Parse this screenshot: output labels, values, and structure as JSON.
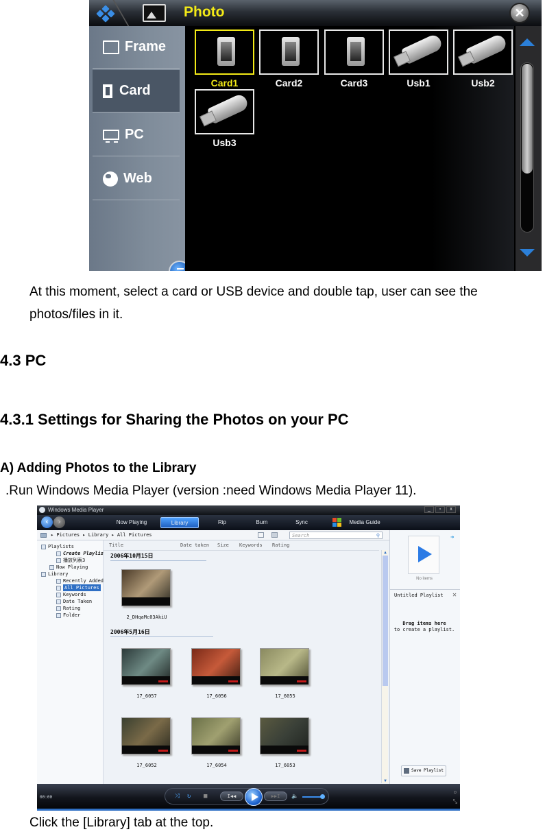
{
  "photo_app": {
    "title": "Photo",
    "sidebar": [
      {
        "label": "Frame",
        "icon": "frame-icon",
        "active": false
      },
      {
        "label": "Card",
        "icon": "card-icon",
        "active": true
      },
      {
        "label": "PC",
        "icon": "pc-icon",
        "active": false
      },
      {
        "label": "Web",
        "icon": "globe-icon",
        "active": false
      }
    ],
    "devices": [
      {
        "label": "Card1",
        "type": "sd-card",
        "selected": true
      },
      {
        "label": "Card2",
        "type": "sd-card",
        "selected": false
      },
      {
        "label": "Card3",
        "type": "sd-card",
        "selected": false
      },
      {
        "label": "Usb1",
        "type": "usb-drive",
        "selected": false
      },
      {
        "label": "Usb2",
        "type": "usb-drive",
        "selected": false
      },
      {
        "label": "Usb3",
        "type": "usb-drive",
        "selected": false
      }
    ],
    "accent_color": "#f3ea17",
    "close_glyph": "✕"
  },
  "document": {
    "para1": "At this moment, select a card or USB device and double tap, user can see the photos/files in it.",
    "heading_43": "4.3 PC",
    "heading_431": "4.3.1 Settings for Sharing the Photos on your PC",
    "heading_a": "A) Adding Photos to the Library",
    "run_line": ".Run Windows Media Player (version :need Windows Media Player 11).",
    "caption": "Click the [Library] tab at the top."
  },
  "wmp": {
    "window_title": "Windows Media Player",
    "window_buttons": [
      "_",
      "▫",
      "x"
    ],
    "back_glyph": "‹",
    "forward_glyph": "›",
    "tabs": [
      {
        "label": "Now Playing",
        "active": false
      },
      {
        "label": "Library",
        "active": true
      },
      {
        "label": "Rip",
        "active": false
      },
      {
        "label": "Burn",
        "active": false
      },
      {
        "label": "Sync",
        "active": false
      },
      {
        "label": "Media Guide",
        "active": false
      }
    ],
    "breadcrumb": "▸ Pictures  ▸ Library  ▸ All Pictures",
    "search_placeholder": "Search",
    "nav_tree": [
      {
        "label": "Playlists",
        "indent": 0,
        "selected": false,
        "italic": false
      },
      {
        "label": "Create Playlist",
        "indent": 1,
        "selected": false,
        "italic": true
      },
      {
        "label": "播放列表3",
        "indent": 1,
        "selected": false,
        "italic": false
      },
      {
        "label": "Now Playing",
        "indent": 0,
        "selected": false,
        "italic": false
      },
      {
        "label": "Library",
        "indent": 0,
        "selected": false,
        "italic": false
      },
      {
        "label": "Recently Added",
        "indent": 1,
        "selected": false,
        "italic": false
      },
      {
        "label": "All Pictures",
        "indent": 1,
        "selected": true,
        "italic": false
      },
      {
        "label": "Keywords",
        "indent": 1,
        "selected": false,
        "italic": false
      },
      {
        "label": "Date Taken",
        "indent": 1,
        "selected": false,
        "italic": false
      },
      {
        "label": "Rating",
        "indent": 1,
        "selected": false,
        "italic": false
      },
      {
        "label": "Folder",
        "indent": 1,
        "selected": false,
        "italic": false
      }
    ],
    "columns": [
      "Title",
      "Date taken",
      "Size",
      "Keywords",
      "Rating"
    ],
    "groups": [
      {
        "header": "2006年10月15日",
        "photos": [
          "2_DHqaMc03AkiU"
        ]
      },
      {
        "header": "2006年5月16日",
        "photos": [
          "17_6057",
          "17_6056",
          "17_6055",
          "17_6052",
          "17_6054",
          "17_6053"
        ]
      }
    ],
    "list_pane": {
      "no_items": "No items",
      "playlist_title": "Untitled Playlist",
      "close_glyph": "✕",
      "drag_bold": "Drag items here",
      "drag_rest": "to create a playlist.",
      "save_button": "Save Playlist"
    },
    "status_text": "00:00",
    "volume_fraction": 0.9,
    "controls": {
      "prev": "I◀◀",
      "next": "▶▶I",
      "stop": "■",
      "shuffle": "⤨",
      "repeat": "↻",
      "mute": "🔈"
    }
  }
}
